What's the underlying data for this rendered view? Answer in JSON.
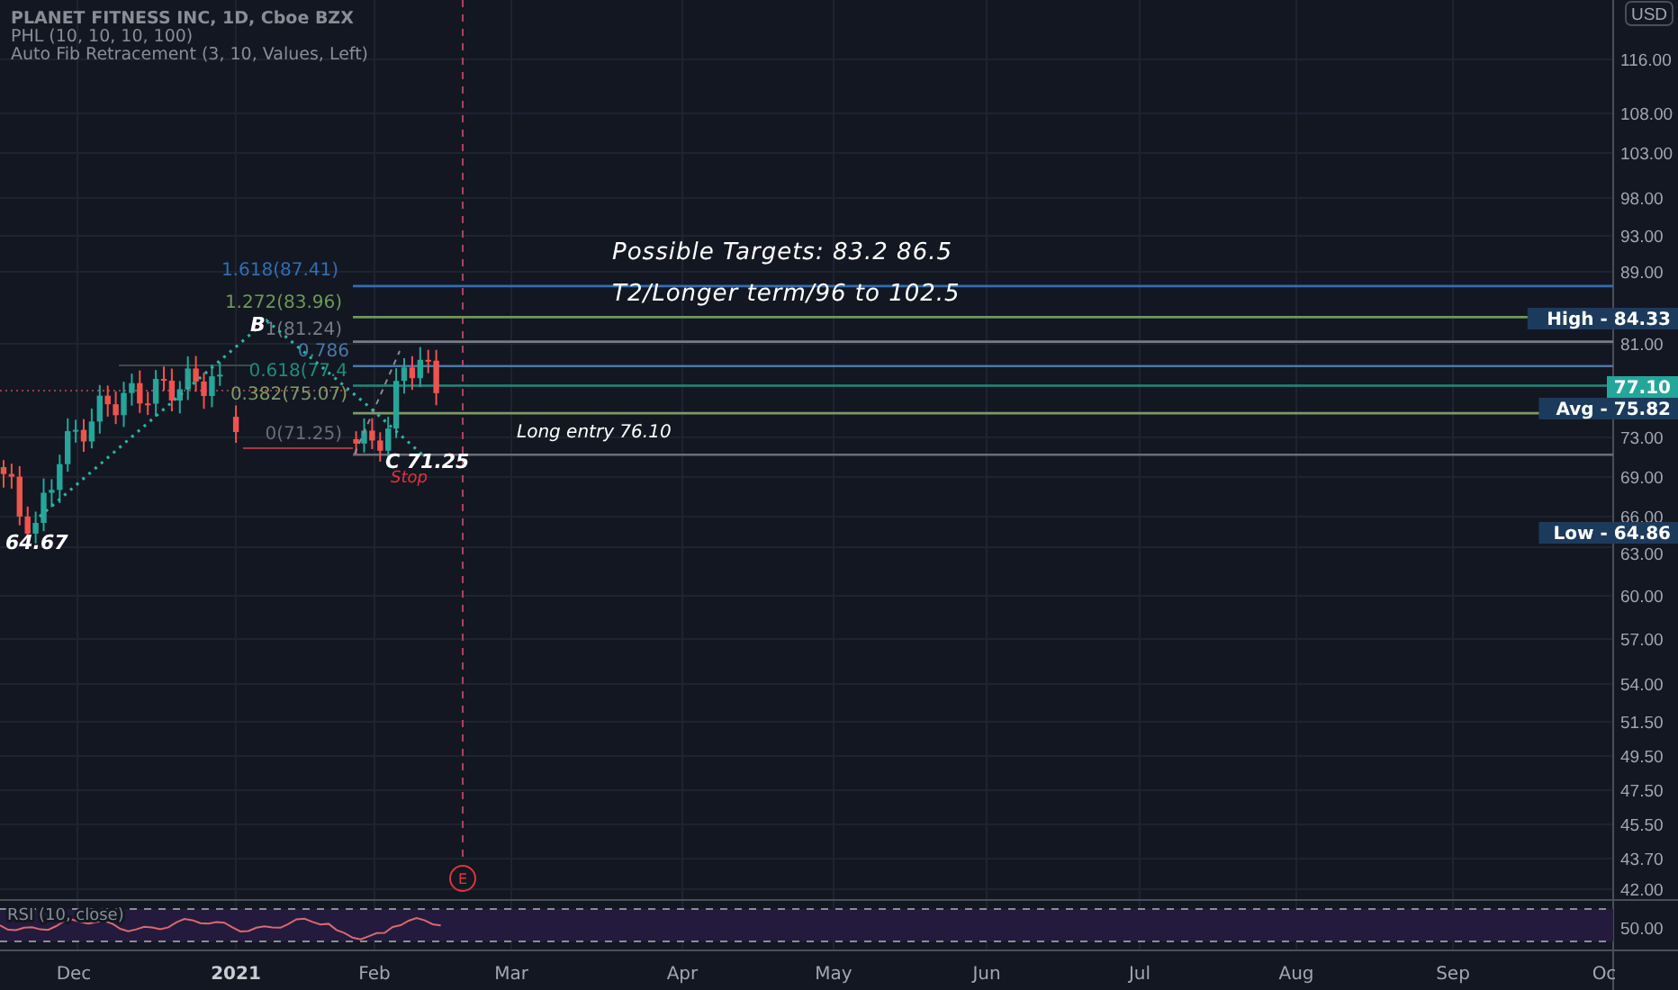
{
  "legend": {
    "title": "PLANET FITNESS INC, 1D, Cboe BZX",
    "indicators": [
      "PHL (10, 10, 10, 100)",
      "Auto Fib Retracement (3, 10, Values, Left)"
    ]
  },
  "price_axis": {
    "currency": "USD",
    "ticks": [
      "116.00",
      "108.00",
      "103.00",
      "98.00",
      "93.00",
      "89.00",
      "81.00",
      "73.00",
      "69.00",
      "66.00",
      "63.00",
      "60.00",
      "57.00",
      "54.00",
      "51.50",
      "49.50",
      "47.50",
      "45.50",
      "43.70",
      "42.00"
    ]
  },
  "price_labels": [
    {
      "kind": "level",
      "text": "High - 84.33"
    },
    {
      "kind": "last",
      "text": "77.10"
    },
    {
      "kind": "level",
      "text": "Avg - 75.82"
    },
    {
      "kind": "level",
      "text": "Low - 64.86"
    }
  ],
  "fib_levels": [
    {
      "label": "1.618(87.41)",
      "color": "#2f6fb4"
    },
    {
      "label": "1.272(83.96)",
      "color": "#6d9a55"
    },
    {
      "label": "1(81.24)",
      "color": "#787b86"
    },
    {
      "label": "0.786",
      "color": "#4a78a8"
    },
    {
      "label": "0.618(77.4",
      "color": "#1f8c7c"
    },
    {
      "label": "0.382(75.07)",
      "color": "#7f9a66"
    },
    {
      "label": "0(71.25)",
      "color": "#6a6d78"
    }
  ],
  "annotations": [
    {
      "kind": "note",
      "text": "Possible Targets:  83.2  86.5"
    },
    {
      "kind": "note",
      "text": "T2/Longer term/96 to 102.5"
    },
    {
      "kind": "point",
      "text": "B"
    },
    {
      "kind": "point",
      "text": "64.67"
    },
    {
      "kind": "point",
      "text": "C 71.25"
    },
    {
      "kind": "stop",
      "text": "Stop"
    },
    {
      "kind": "small",
      "text": "Long entry  76.10"
    }
  ],
  "event_marker": {
    "label": "E"
  },
  "rsi": {
    "label": "RSI (10, close)",
    "ticks": [
      "50.00"
    ]
  },
  "time_axis": [
    {
      "label": "Dec",
      "kind": "month"
    },
    {
      "label": "2021",
      "kind": "year"
    },
    {
      "label": "Feb",
      "kind": "month"
    },
    {
      "label": "Mar",
      "kind": "month"
    },
    {
      "label": "Apr",
      "kind": "month"
    },
    {
      "label": "May",
      "kind": "month"
    },
    {
      "label": "Jun",
      "kind": "month"
    },
    {
      "label": "Jul",
      "kind": "month"
    },
    {
      "label": "Aug",
      "kind": "month"
    },
    {
      "label": "Sep",
      "kind": "month"
    },
    {
      "label": "Oc",
      "kind": "month"
    }
  ]
}
